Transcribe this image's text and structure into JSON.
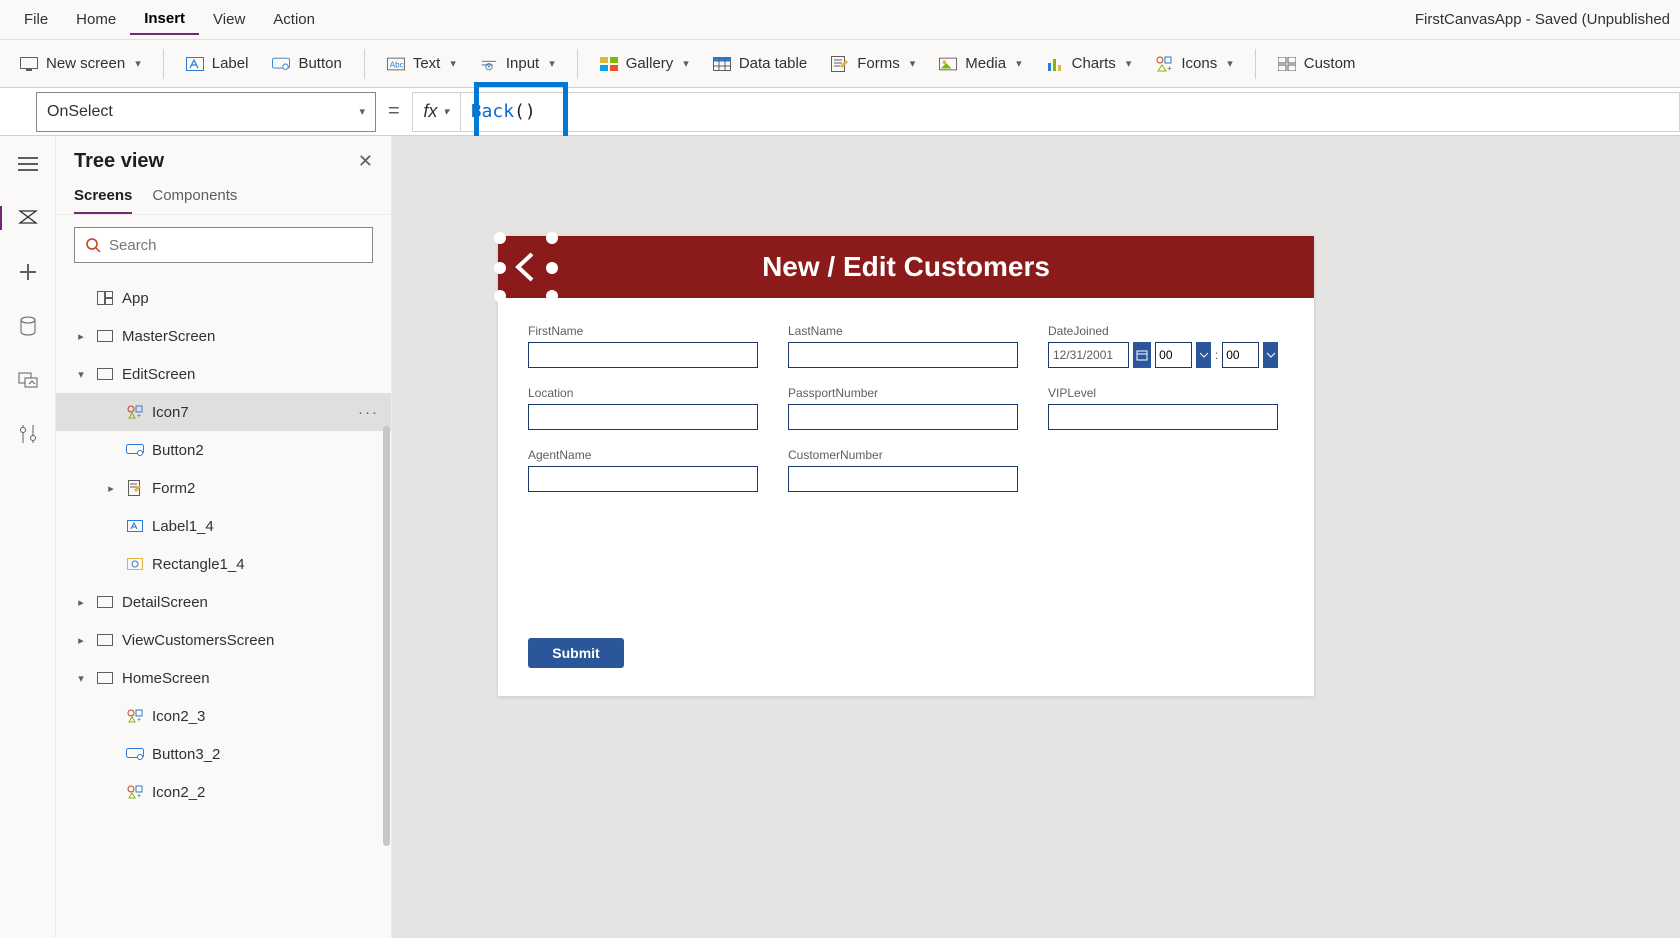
{
  "app_title": "FirstCanvasApp - Saved (Unpublished",
  "menubar": [
    "File",
    "Home",
    "Insert",
    "View",
    "Action"
  ],
  "menubar_active": "Insert",
  "ribbon": {
    "new_screen": "New screen",
    "label": "Label",
    "button": "Button",
    "text": "Text",
    "input": "Input",
    "gallery": "Gallery",
    "data_table": "Data table",
    "forms": "Forms",
    "media": "Media",
    "charts": "Charts",
    "icons": "Icons",
    "custom": "Custom"
  },
  "property_dropdown": "OnSelect",
  "formula_func": "Back",
  "formula_paren": "()",
  "tree": {
    "title": "Tree view",
    "tabs": [
      "Screens",
      "Components"
    ],
    "active_tab": "Screens",
    "search_placeholder": "Search",
    "items": [
      {
        "label": "App",
        "type": "app",
        "indent": 0,
        "expandable": false
      },
      {
        "label": "MasterScreen",
        "type": "screen",
        "indent": 0,
        "expandable": true,
        "expanded": false
      },
      {
        "label": "EditScreen",
        "type": "screen",
        "indent": 0,
        "expandable": true,
        "expanded": true
      },
      {
        "label": "Icon7",
        "type": "icon",
        "indent": 2,
        "selected": true,
        "more": true
      },
      {
        "label": "Button2",
        "type": "button",
        "indent": 2
      },
      {
        "label": "Form2",
        "type": "form",
        "indent": 2,
        "expandable": true,
        "expanded": false
      },
      {
        "label": "Label1_4",
        "type": "label",
        "indent": 2
      },
      {
        "label": "Rectangle1_4",
        "type": "rect",
        "indent": 2
      },
      {
        "label": "DetailScreen",
        "type": "screen",
        "indent": 0,
        "expandable": true,
        "expanded": false
      },
      {
        "label": "ViewCustomersScreen",
        "type": "screen",
        "indent": 0,
        "expandable": true,
        "expanded": false
      },
      {
        "label": "HomeScreen",
        "type": "screen",
        "indent": 0,
        "expandable": true,
        "expanded": true
      },
      {
        "label": "Icon2_3",
        "type": "icon",
        "indent": 2
      },
      {
        "label": "Button3_2",
        "type": "button",
        "indent": 2
      },
      {
        "label": "Icon2_2",
        "type": "icon",
        "indent": 2
      }
    ]
  },
  "canvas": {
    "header_title": "New / Edit Customers",
    "fields": {
      "firstname": "FirstName",
      "lastname": "LastName",
      "datejoined": "DateJoined",
      "location": "Location",
      "passport": "PassportNumber",
      "vip": "VIPLevel",
      "agent": "AgentName",
      "custnum": "CustomerNumber"
    },
    "date_value": "12/31/2001",
    "hour": "00",
    "minute": "00",
    "submit": "Submit"
  }
}
